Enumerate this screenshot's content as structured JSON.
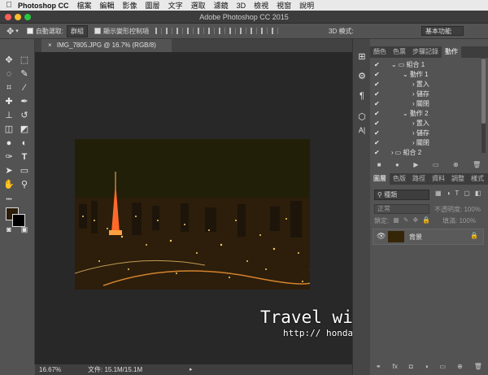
{
  "menubar": {
    "app": "Photoshop CC",
    "items": [
      "檔案",
      "編輯",
      "影像",
      "圖層",
      "文字",
      "選取",
      "濾鏡",
      "3D",
      "檢視",
      "視窗",
      "說明"
    ]
  },
  "title": "Adobe Photoshop CC 2015",
  "options": {
    "auto_select_label": "自動選取:",
    "auto_select_value": "群組",
    "show_transform_label": "顯示變形控制項",
    "mode_3d_label": "3D 模式:",
    "workspace": "基本功能"
  },
  "document": {
    "tab_label": "IMG_7805.JPG @ 16.7% (RGB/8)"
  },
  "status": {
    "zoom": "16.67%",
    "doc_info": "文件: 15.1M/15.1M"
  },
  "actions_panel": {
    "tabs": [
      "顏色",
      "色票",
      "步驟記錄",
      "動作"
    ],
    "rows": [
      "組合 1",
      "動作 1",
      "置入",
      "儲存",
      "關閉",
      "動作 2",
      "置入",
      "儲存",
      "關閉",
      "組合 2"
    ]
  },
  "layers_panel": {
    "tabs": [
      "圖層",
      "色版",
      "路徑",
      "資料",
      "調整",
      "樣式"
    ],
    "kind_label": "種類",
    "blend_mode": "正常",
    "opacity_label": "不透明度:",
    "opacity_value": "100%",
    "lock_label": "鎖定:",
    "fill_label": "填滿:",
    "fill_value": "100%",
    "layer_name": "背景"
  },
  "watermark": {
    "title": "Travel with Honda",
    "url": "http:// hondayellow.pixnet.net"
  },
  "colors": {
    "foreground": "#2b1d0a",
    "background": "#000000",
    "accent": "#2d79d6"
  }
}
